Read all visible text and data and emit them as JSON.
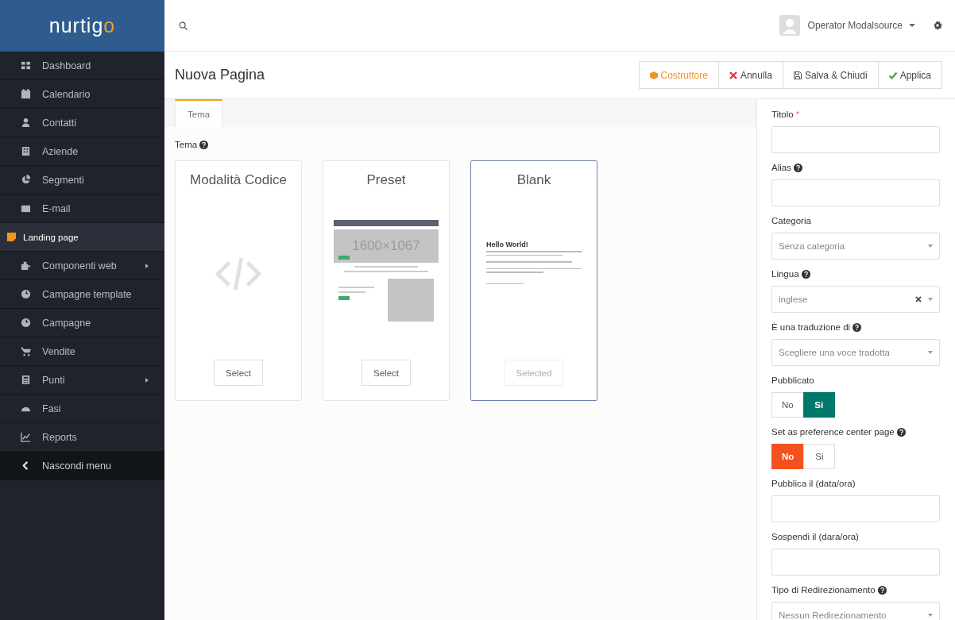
{
  "logo": {
    "text": "nurtig",
    "accent": "o"
  },
  "sidebar": {
    "items": [
      {
        "label": "Dashboard",
        "selected": false,
        "submenu": false
      },
      {
        "label": "Calendario",
        "selected": false,
        "submenu": false
      },
      {
        "label": "Contatti",
        "selected": false,
        "submenu": false
      },
      {
        "label": "Aziende",
        "selected": false,
        "submenu": false
      },
      {
        "label": "Segmenti",
        "selected": false,
        "submenu": false
      },
      {
        "label": "E-mail",
        "selected": false,
        "submenu": false
      },
      {
        "label": "Landing page",
        "selected": true,
        "submenu": false
      },
      {
        "label": "Componenti web",
        "selected": false,
        "submenu": true
      },
      {
        "label": "Campagne template",
        "selected": false,
        "submenu": false
      },
      {
        "label": "Campagne",
        "selected": false,
        "submenu": false
      },
      {
        "label": "Vendite",
        "selected": false,
        "submenu": false
      },
      {
        "label": "Punti",
        "selected": false,
        "submenu": true
      },
      {
        "label": "Fasi",
        "selected": false,
        "submenu": false
      },
      {
        "label": "Reports",
        "selected": false,
        "submenu": false
      }
    ],
    "collapse": {
      "label": "Nascondi menu"
    }
  },
  "topbar": {
    "user": "Operator Modalsource"
  },
  "page": {
    "title": "Nuova Pagina",
    "buttons": [
      {
        "label": "Costruttore",
        "kind": "builder"
      },
      {
        "label": "Annulla",
        "kind": "cancel"
      },
      {
        "label": "Salva & Chiudi",
        "kind": "save"
      },
      {
        "label": "Applica",
        "kind": "apply"
      }
    ]
  },
  "tabs": [
    {
      "label": "Tema",
      "selected": true
    }
  ],
  "theme": {
    "label": "Tema",
    "cards": [
      {
        "title": "Modalità Codice",
        "kind": "code",
        "button": "Select",
        "selected": false
      },
      {
        "title": "Preset",
        "kind": "preset",
        "button": "Select",
        "selected": false,
        "preview_text": "1600×1067"
      },
      {
        "title": "Blank",
        "kind": "blank",
        "button": "Selected",
        "selected": true,
        "preview_text": "Hello World!"
      }
    ]
  },
  "form": [
    {
      "kind": "text",
      "label": "Titolo",
      "required_mark": "*",
      "help": false
    },
    {
      "kind": "text",
      "label": "Alias",
      "help": true
    },
    {
      "kind": "select",
      "label": "Categoria",
      "help": false,
      "value": "Senza categoria",
      "clearable": false
    },
    {
      "kind": "select",
      "label": "Lingua",
      "help": true,
      "value": "inglese",
      "clearable": true
    },
    {
      "kind": "select",
      "label": "È una traduzione di",
      "help": true,
      "value": "Scegliere una voce tradotta",
      "clearable": false
    },
    {
      "kind": "toggle",
      "label": "Pubblicato",
      "help": false,
      "options": [
        {
          "label": "No",
          "selected": false
        },
        {
          "label": "Si",
          "selected": true
        }
      ]
    },
    {
      "kind": "toggle",
      "label": "Set as preference center page",
      "help": true,
      "options": [
        {
          "label": "No",
          "selected": true
        },
        {
          "label": "Si",
          "selected": false
        }
      ]
    },
    {
      "kind": "text",
      "label": "Pubblica il (data/ora)",
      "help": false
    },
    {
      "kind": "text",
      "label": "Sospendi il (dara/ora)",
      "help": false
    },
    {
      "kind": "select",
      "label": "Tipo di Redirezionamento",
      "help": true,
      "value": "Nessun Redirezionamento",
      "clearable": false
    }
  ]
}
